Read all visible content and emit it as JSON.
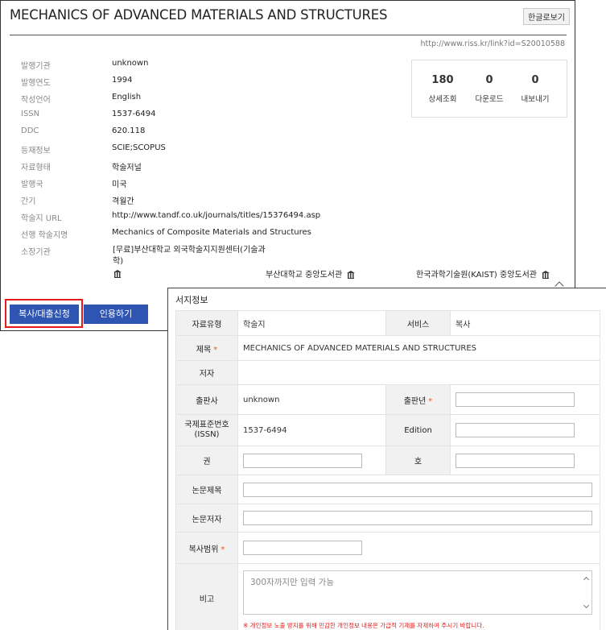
{
  "header": {
    "title": "MECHANICS OF ADVANCED MATERIALS AND STRUCTURES",
    "korean_view_label": "한글로보기",
    "link": "http://www.riss.kr/link?id=S20010588"
  },
  "info": [
    {
      "label": "발행기관",
      "value": "unknown"
    },
    {
      "label": "발행연도",
      "value": "1994"
    },
    {
      "label": "작성언어",
      "value": "English"
    },
    {
      "label": "ISSN",
      "value": "1537-6494"
    },
    {
      "label": "DDC",
      "value": "620.118"
    },
    {
      "label": "등재정보",
      "value": "SCIE;SCOPUS"
    },
    {
      "label": "자료형태",
      "value": "학술저널"
    },
    {
      "label": "발행국",
      "value": "미국"
    },
    {
      "label": "간기",
      "value": "격월간"
    },
    {
      "label": "학술지 URL",
      "value": "http://www.tandf.co.uk/journals/titles/15376494.asp"
    },
    {
      "label": "선행 학술지명",
      "value": "Mechanics of Composite Materials and Structures"
    },
    {
      "label": "소장기관",
      "value": ""
    }
  ],
  "holdings": [
    "[무료]부산대학교 외국학술지지원센터(기술과학)",
    "부산대학교 중앙도서관",
    "한국과학기술원(KAIST) 중앙도서관"
  ],
  "stats": [
    {
      "num": "180",
      "label": "상세조회"
    },
    {
      "num": "0",
      "label": "다운로드"
    },
    {
      "num": "0",
      "label": "내보내기"
    }
  ],
  "buttons": {
    "copy": "복사/대출신청",
    "cite": "인용하기"
  },
  "form": {
    "title": "서지정보",
    "material_type_label": "자료유형",
    "material_type_value": "학술지",
    "service_label": "서비스",
    "service_value": "복사",
    "title_label": "제목",
    "title_value": "MECHANICS OF ADVANCED MATERIALS AND STRUCTURES",
    "author_label": "저자",
    "publisher_label": "출판사",
    "publisher_value": "unknown",
    "pub_year_label": "출판년",
    "issn_label_line1": "국제표준번호",
    "issn_label_line2": "(ISSN)",
    "issn_value": "1537-6494",
    "edition_label": "Edition",
    "volume_label": "권",
    "number_label": "호",
    "article_title_label": "논문제목",
    "article_author_label": "논문저자",
    "copy_range_label": "복사범위",
    "remarks_label": "비고",
    "remarks_placeholder": "300자까지만 입력 가능",
    "notice": "※ 개인정보 노출 방지를 위해 민감한 개인정보 내용은 가급적 기재를 자제하여 주시기 바랍니다.",
    "required_mark": "*"
  },
  "colors": {
    "button_blue": "#2f55b3",
    "highlight_red": "#e31b1b",
    "required_orange": "#e15b1e"
  }
}
